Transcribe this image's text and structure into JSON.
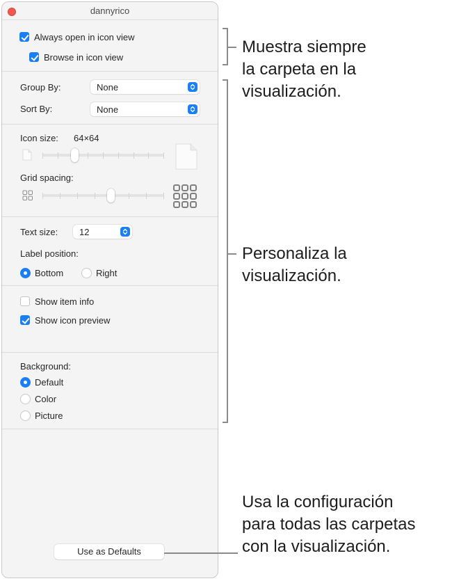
{
  "window": {
    "title": "dannyrico"
  },
  "view_options": {
    "always_open": {
      "label": "Always open in icon view",
      "checked": true
    },
    "browse": {
      "label": "Browse in icon view",
      "checked": true
    },
    "group_by": {
      "label": "Group By:",
      "value": "None"
    },
    "sort_by": {
      "label": "Sort By:",
      "value": "None"
    },
    "icon_size": {
      "label": "Icon size:",
      "value": "64×64",
      "slider_fraction": 0.25
    },
    "grid_spacing": {
      "label": "Grid spacing:",
      "slider_fraction": 0.57
    },
    "text_size": {
      "label": "Text size:",
      "value": "12"
    },
    "label_position": {
      "label": "Label position:",
      "options": [
        {
          "label": "Bottom",
          "selected": true
        },
        {
          "label": "Right",
          "selected": false
        }
      ]
    },
    "show_item_info": {
      "label": "Show item info",
      "checked": false
    },
    "show_icon_preview": {
      "label": "Show icon preview",
      "checked": true
    },
    "background": {
      "label": "Background:",
      "options": [
        {
          "label": "Default",
          "selected": true
        },
        {
          "label": "Color",
          "selected": false
        },
        {
          "label": "Picture",
          "selected": false
        }
      ]
    },
    "use_as_defaults": "Use as Defaults"
  },
  "callouts": {
    "top": "Muestra siempre\nla carpeta en la\nvisualización.",
    "middle": "Personaliza la\nvisualización.",
    "bottom": "Usa la configuración\npara todas las carpetas\ncon la visualización."
  },
  "colors": {
    "accent": "#1a7ff5",
    "close": "#ee5a52",
    "window_bg": "#f4f4f4"
  }
}
